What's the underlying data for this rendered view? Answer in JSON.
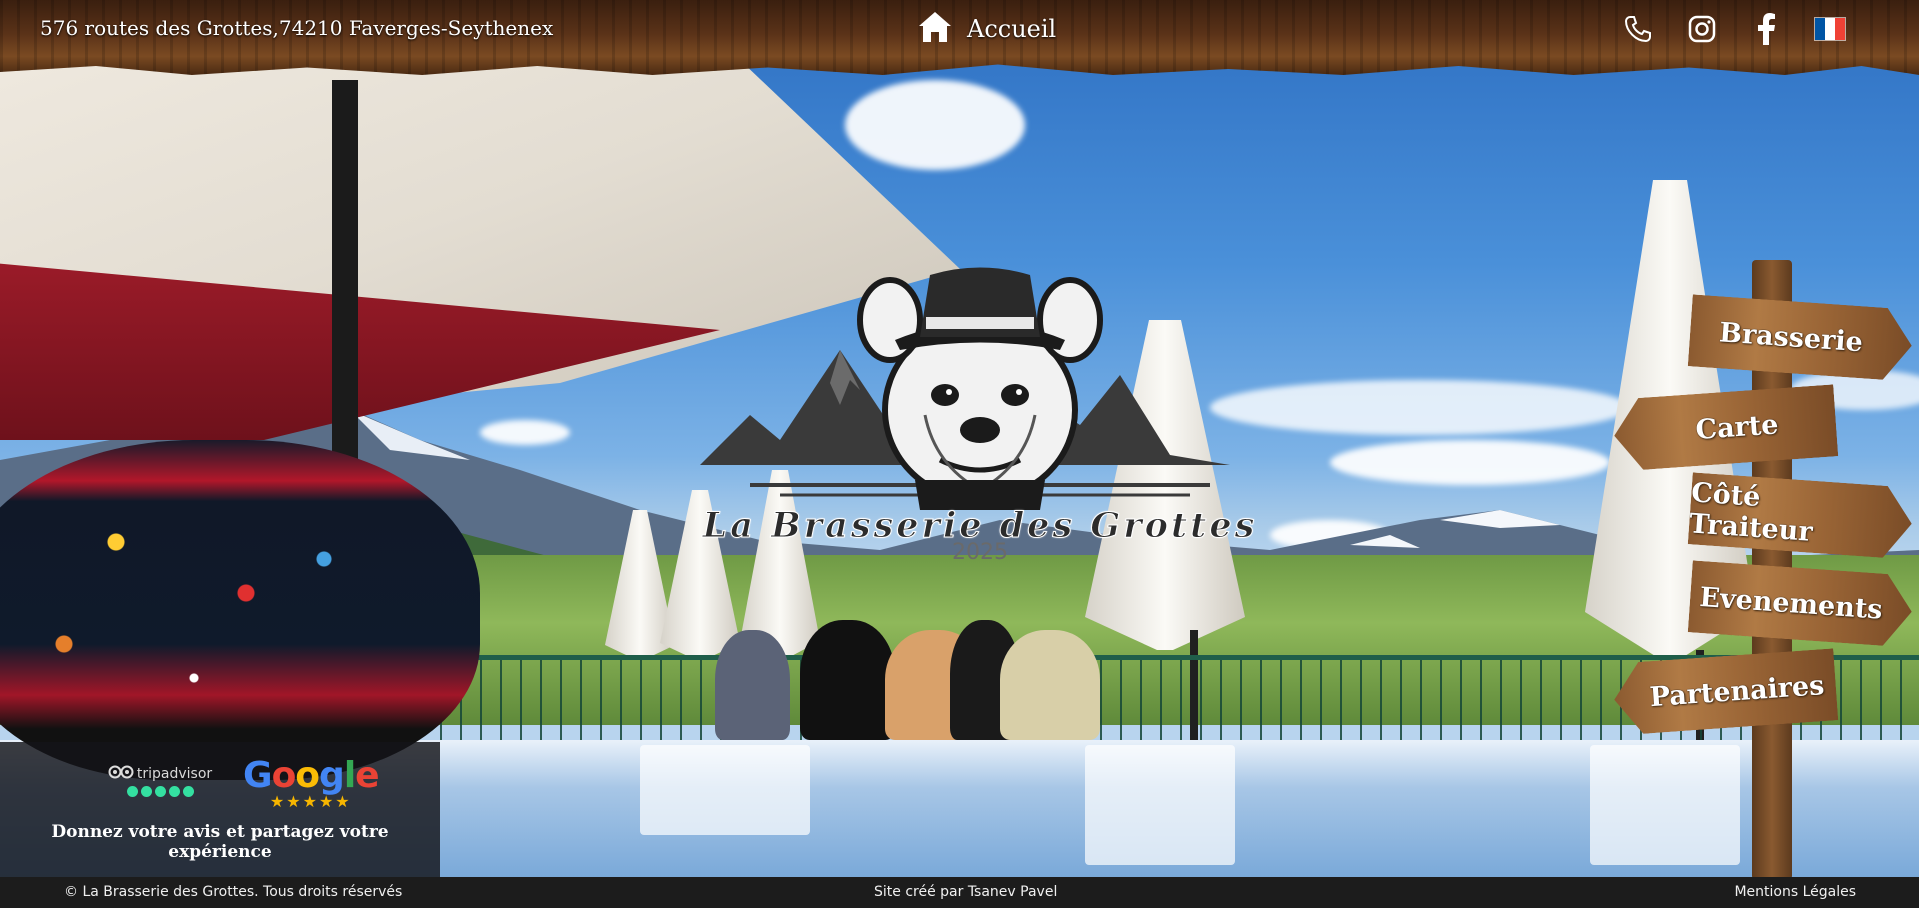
{
  "header": {
    "address": "576 routes des Grottes,74210 Faverges-Seythenex",
    "home_label": "Accueil",
    "home_icon": "home-icon",
    "icons": [
      "phone-icon",
      "instagram-icon",
      "facebook-icon",
      "french-flag-icon"
    ],
    "flag_colors": [
      "#0055a4",
      "#ffffff",
      "#ef4135"
    ]
  },
  "logo": {
    "title": "La Brasserie des Grottes",
    "year": "2025"
  },
  "nav": {
    "brasserie": "Brasserie",
    "carte": "Carte",
    "traiteur": "Côté Traiteur",
    "evenements": "Evenements",
    "partenaires": "Partenaires"
  },
  "reviews": {
    "tripadvisor": "tripadvisor",
    "google": "Google",
    "stars": "★★★★★",
    "cta": "Donnez votre avis et partagez votre expérience"
  },
  "footer": {
    "copyright": "© La Brasserie des Grottes. Tous droits réservés",
    "credit": "Site créé par Tsanev Pavel",
    "legal": "Mentions Légales"
  }
}
